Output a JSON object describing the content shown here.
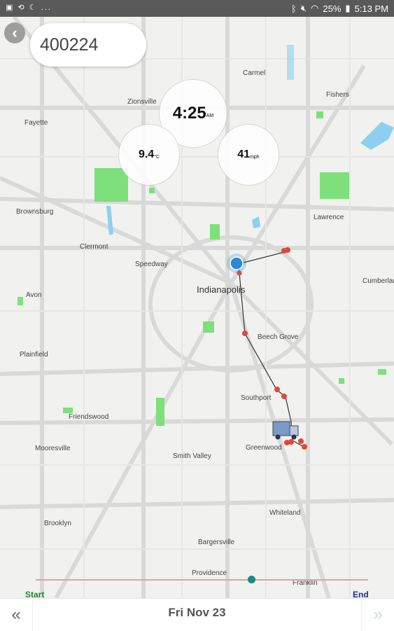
{
  "status_bar": {
    "left_icons": "▣ ⟲ ☾ ...",
    "battery": "25%",
    "time": "5:13 PM"
  },
  "header": {
    "back_icon": "chevron-left-icon",
    "vehicle_id": "400224"
  },
  "stats": {
    "time": "4:25",
    "time_suffix": "AM",
    "temperature": "9.4",
    "temperature_unit": "°C",
    "speed": "41",
    "speed_unit": "mph"
  },
  "map": {
    "places": {
      "carmel": "Carmel",
      "zionsville": "Zionsville",
      "fishers": "Fishers",
      "fayette": "Fayette",
      "brownsburg": "Brownsburg",
      "clermont": "Clermont",
      "speedway": "Speedway",
      "lawrence": "Lawrence",
      "cumberland": "Cumberland",
      "indianapolis": "Indianapolis",
      "avon": "Avon",
      "beech_grove": "Beech Grove",
      "plainfield": "Plainfield",
      "southport": "Southport",
      "friendswood": "Friendswood",
      "mooresville": "Mooresville",
      "smith_valley": "Smith Valley",
      "greenwood": "Greenwood",
      "whiteland": "Whiteland",
      "brooklyn": "Brooklyn",
      "bargersville": "Bargersville",
      "providence": "Providence",
      "franklin": "Franklin"
    },
    "colors": {
      "route": "#333333",
      "marker": "#e2473b",
      "current": "#2a8ad8",
      "park": "#7ee07a",
      "water": "#8cd0f0"
    }
  },
  "slider": {
    "start_label": "Start",
    "end_label": "End",
    "position": 0.64
  },
  "footer": {
    "prev_icon": "double-chevron-left-icon",
    "date": "Fri Nov 23",
    "next_icon": "double-chevron-right-icon"
  }
}
